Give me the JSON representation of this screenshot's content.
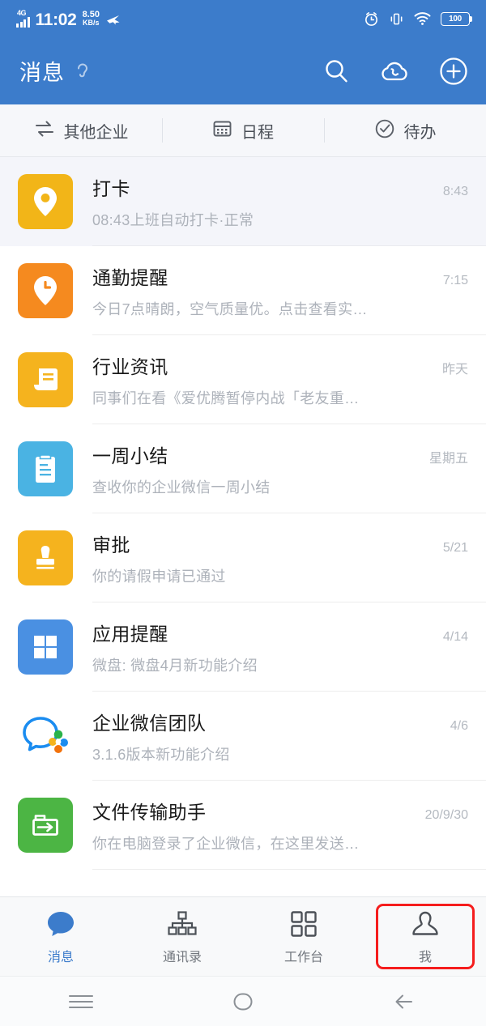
{
  "status_bar": {
    "network_type": "4G",
    "time": "11:02",
    "net_speed_value": "8.50",
    "net_speed_unit": "KB/s",
    "icons": [
      "signal-bars-icon",
      "location-arrow-icon",
      "alarm-icon",
      "vibrate-icon",
      "wifi-icon"
    ],
    "battery_level": "100"
  },
  "app_bar": {
    "title": "消息",
    "mute_icon": "ear-mute-icon",
    "actions": [
      {
        "name": "search-icon",
        "label": "搜索"
      },
      {
        "name": "cloud-call-icon",
        "label": "云电话"
      },
      {
        "name": "plus-circle-icon",
        "label": "添加"
      }
    ]
  },
  "quick_tabs": [
    {
      "icon": "switch-arrows-icon",
      "label": "其他企业"
    },
    {
      "icon": "calendar-icon",
      "label": "日程"
    },
    {
      "icon": "check-circle-icon",
      "label": "待办"
    }
  ],
  "conversations": [
    {
      "icon": "location-pin-icon",
      "avatar_color": "#f2b518",
      "name": "打卡",
      "preview": "08:43上班自动打卡·正常",
      "time": "8:43",
      "selected": true
    },
    {
      "icon": "clock-pin-icon",
      "avatar_color": "#f58a1f",
      "name": "通勤提醒",
      "preview": "今日7点晴朗，空气质量优。点击查看实…",
      "time": "7:15",
      "selected": false
    },
    {
      "icon": "news-document-icon",
      "avatar_color": "#f5b31e",
      "name": "行业资讯",
      "preview": "同事们在看《爱优腾暂停内战「老友重…",
      "time": "昨天",
      "selected": false
    },
    {
      "icon": "clipboard-icon",
      "avatar_color": "#4ab3e3",
      "name": "一周小结",
      "preview": "查收你的企业微信一周小结",
      "time": "星期五",
      "selected": false
    },
    {
      "icon": "stamp-icon",
      "avatar_color": "#f5b31e",
      "name": "审批",
      "preview": "你的请假申请已通过",
      "time": "5/21",
      "selected": false
    },
    {
      "icon": "grid-apps-icon",
      "avatar_color": "#4a90e2",
      "name": "应用提醒",
      "preview": "微盘: 微盘4月新功能介绍",
      "time": "4/14",
      "selected": false
    },
    {
      "icon": "wecom-logo-icon",
      "avatar_color": "transparent",
      "name": "企业微信团队",
      "preview": "3.1.6版本新功能介绍",
      "time": "4/6",
      "selected": false
    },
    {
      "icon": "file-transfer-icon",
      "avatar_color": "#4cb544",
      "name": "文件传输助手",
      "preview": "你在电脑登录了企业微信，在这里发送…",
      "time": "20/9/30",
      "selected": false
    }
  ],
  "tab_bar": {
    "active_accent": "#3c7ccb",
    "highlight_color": "#f51d1d",
    "items": [
      {
        "icon": "chat-bubble-icon",
        "label": "消息",
        "active": true,
        "highlighted": false
      },
      {
        "icon": "org-tree-icon",
        "label": "通讯录",
        "active": false,
        "highlighted": false
      },
      {
        "icon": "grid-squares-icon",
        "label": "工作台",
        "active": false,
        "highlighted": false
      },
      {
        "icon": "person-icon",
        "label": "我",
        "active": false,
        "highlighted": true
      }
    ]
  },
  "system_nav": [
    {
      "icon": "recents-menu-icon",
      "label": "最近任务"
    },
    {
      "icon": "home-circle-icon",
      "label": "主页"
    },
    {
      "icon": "back-arrow-icon",
      "label": "返回"
    }
  ]
}
